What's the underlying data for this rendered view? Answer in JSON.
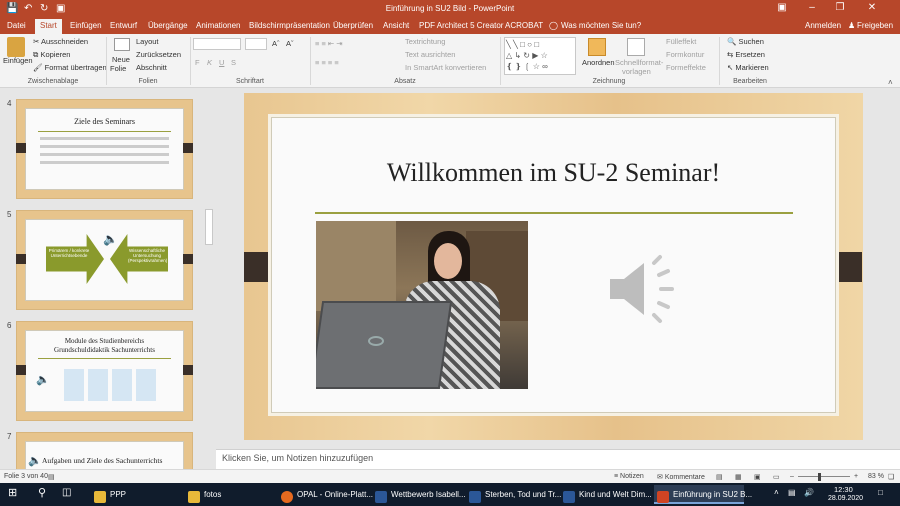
{
  "titlebar": {
    "title": "Einführung in SU2 Bild - PowerPoint",
    "signin": "Anmelden",
    "share": "Freigeben"
  },
  "tabs": [
    "Datei",
    "Start",
    "Einfügen",
    "Entwurf",
    "Übergänge",
    "Animationen",
    "Bildschirmpräsentation",
    "Überprüfen",
    "Ansicht",
    "PDF Architect 5 Creator",
    "ACROBAT"
  ],
  "tellme": "Was möchten Sie tun?",
  "ribbon": {
    "clipboard": {
      "paste": "Einfügen",
      "cut": "Ausschneiden",
      "copy": "Kopieren",
      "format_painter": "Format übertragen",
      "group": "Zwischenablage"
    },
    "slides": {
      "new_slide": "Neue",
      "new_slide2": "Folie",
      "layout": "Layout",
      "reset": "Zurücksetzen",
      "section": "Abschnitt",
      "group": "Folien"
    },
    "font": {
      "bold": "F",
      "italic": "K",
      "underline": "U",
      "strike": "S",
      "group": "Schriftart"
    },
    "paragraph": {
      "text_direction": "Textrichtung",
      "align_text": "Text ausrichten",
      "smartart": "In SmartArt konvertieren",
      "group": "Absatz"
    },
    "drawing": {
      "arrange": "Anordnen",
      "quick_styles": "Schnellformat-",
      "quick_styles2": "vorlagen",
      "fill": "Fülleffekt",
      "outline": "Formkontur",
      "effects": "Formeffekte",
      "group": "Zeichnung"
    },
    "editing": {
      "find": "Suchen",
      "replace": "Ersetzen",
      "select": "Markieren",
      "group": "Bearbeiten"
    }
  },
  "thumbnails": [
    {
      "num": "4",
      "title": "Ziele des Seminars"
    },
    {
      "num": "5",
      "left": "Primärem / konkrete Unterrichtsebende",
      "right": "Wissenschaftliche Untersuchung (Perspektivrahmen)"
    },
    {
      "num": "6",
      "title": "Module des Studienbereichs Grundschuldidaktik Sachunterrichts"
    },
    {
      "num": "7",
      "title": "Aufgaben und Ziele des Sachunterrichts"
    }
  ],
  "slide": {
    "title": "Willkommen im SU-2 Seminar!"
  },
  "notes_placeholder": "Klicken Sie, um Notizen hinzuzufügen",
  "status": {
    "slide_of": "Folie 3 von 40",
    "notes": "Notizen",
    "comments": "Kommentare",
    "zoom": "83 %"
  },
  "taskbar": {
    "items": [
      "PPP",
      "fotos",
      "OPAL - Online-Platt...",
      "Wettbewerb Isabell...",
      "Sterben, Tod und Tr...",
      "Kind und Welt Dim...",
      "Einführung in SU2 B..."
    ],
    "time": "12:30",
    "date": "28.09.2020"
  },
  "colors": {
    "accent": "#b7472a",
    "wood": "#e8c690",
    "divider": "#9aa040"
  }
}
